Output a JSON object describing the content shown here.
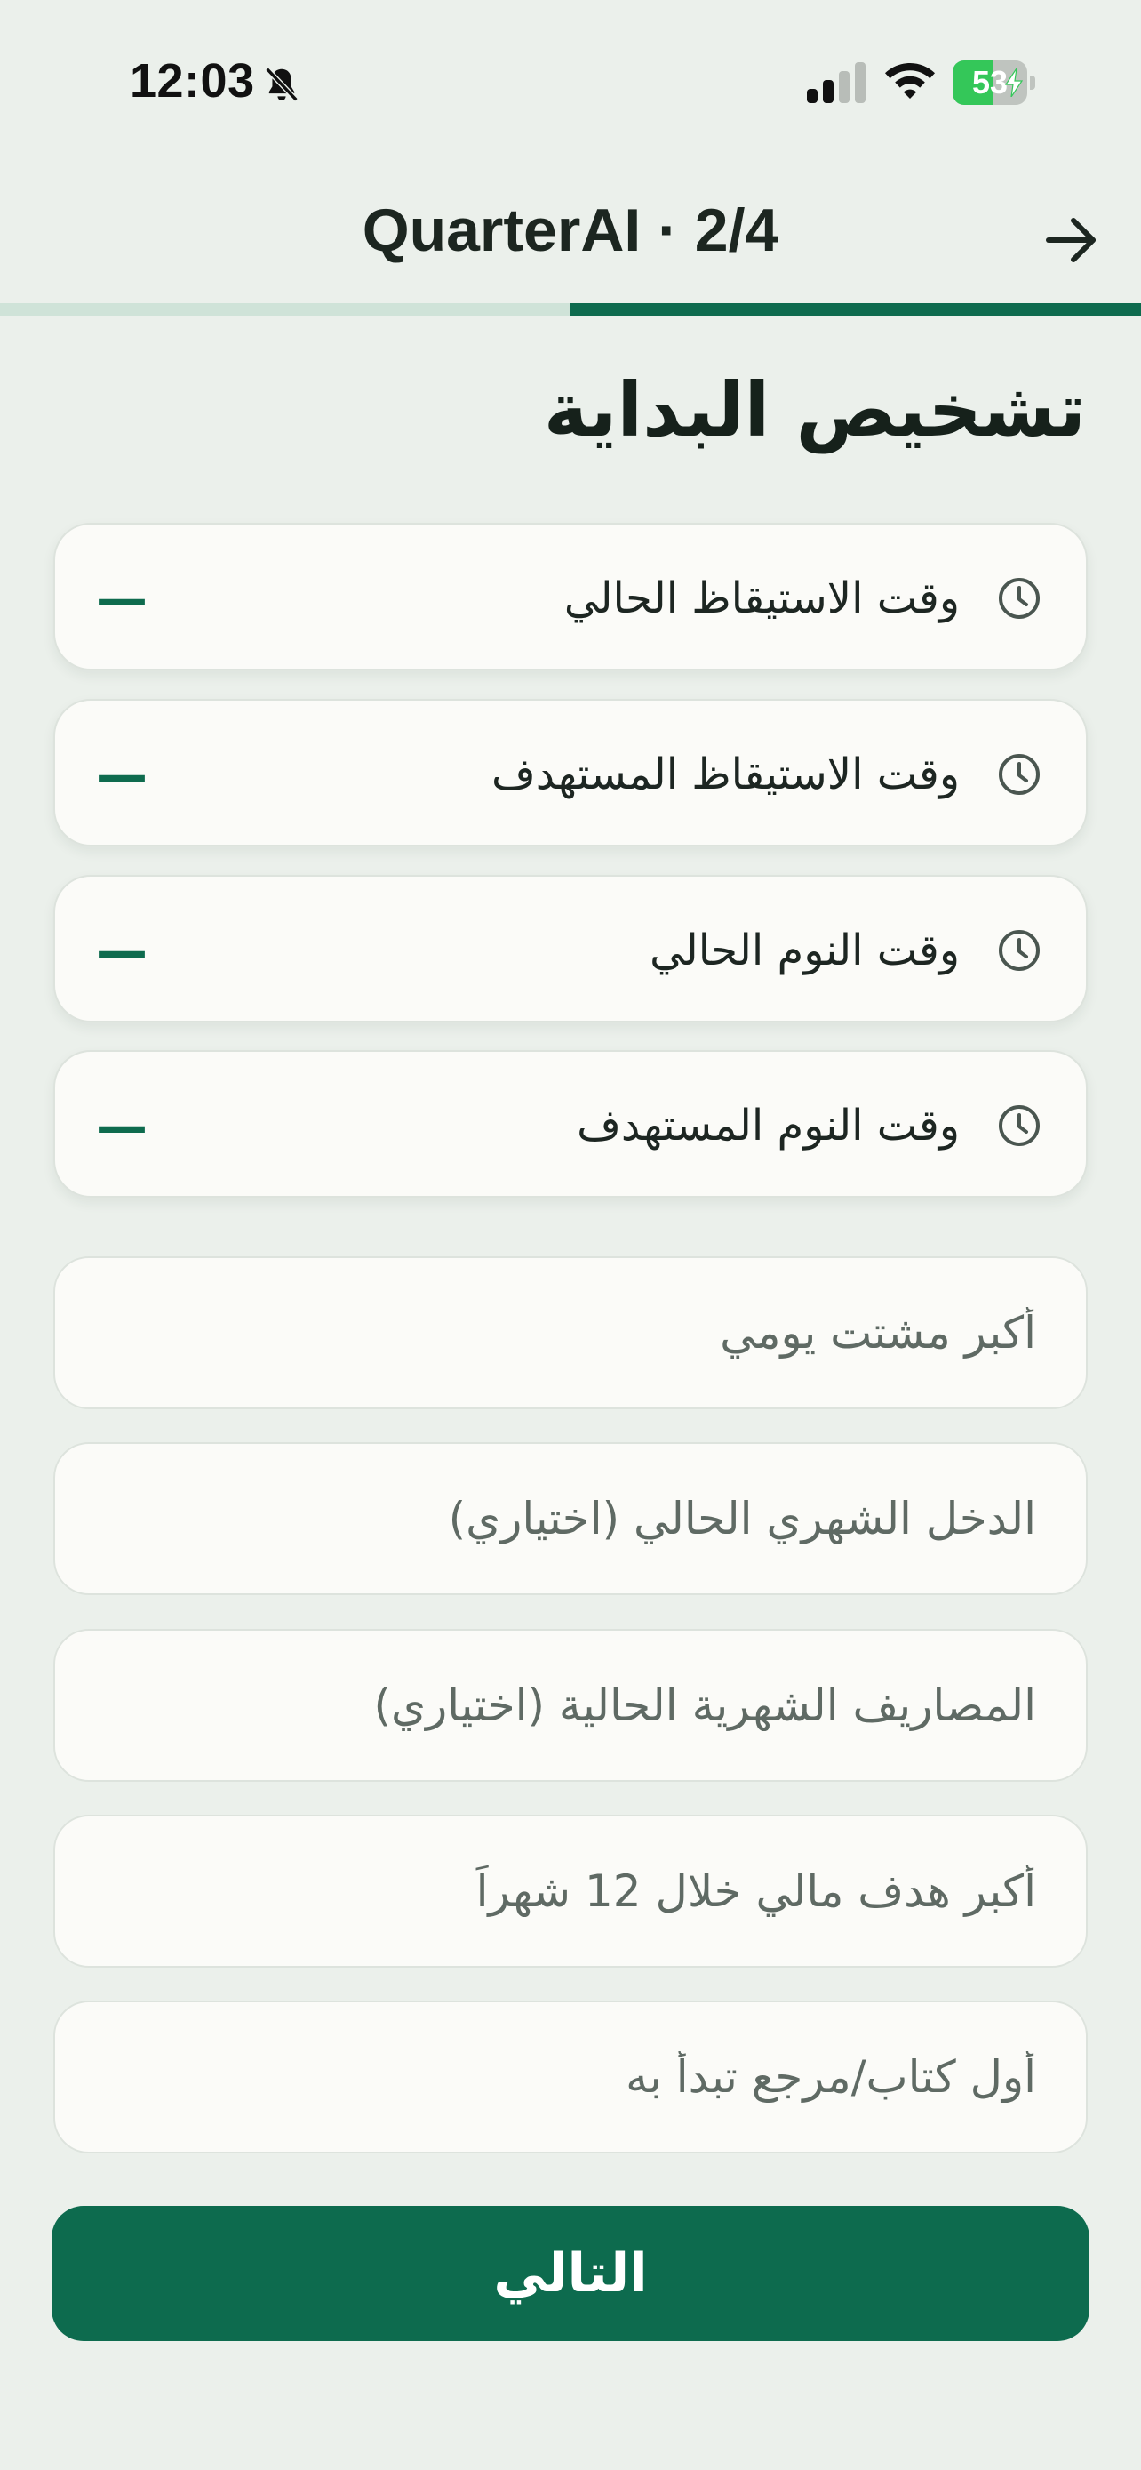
{
  "status_bar": {
    "time": "12:03",
    "battery_level": "53",
    "battery_fraction": 0.53,
    "silent_mode": true,
    "signal_bars_active": 2,
    "signal_bars_total": 4
  },
  "header": {
    "title": "QuarterAI · 2/4",
    "back_icon": "arrow-right-icon"
  },
  "progress": {
    "step": 2,
    "total": 4,
    "fraction": 0.5,
    "fill_color": "#0e6b4e",
    "track_color": "#cfe3d8"
  },
  "page": {
    "title": "تشخيص البداية"
  },
  "time_rows": [
    {
      "label": "وقت الاستيقاظ الحالي",
      "value": "—",
      "icon": "clock-icon"
    },
    {
      "label": "وقت الاستيقاظ المستهدف",
      "value": "—",
      "icon": "clock-icon"
    },
    {
      "label": "وقت النوم الحالي",
      "value": "—",
      "icon": "clock-icon"
    },
    {
      "label": "وقت النوم المستهدف",
      "value": "—",
      "icon": "clock-icon"
    }
  ],
  "fields": [
    {
      "placeholder": "أكبر مشتت يومي",
      "value": ""
    },
    {
      "placeholder": "الدخل الشهري الحالي (اختياري)",
      "value": ""
    },
    {
      "placeholder": "المصاريف الشهرية الحالية (اختياري)",
      "value": ""
    },
    {
      "placeholder": "أكبر هدف مالي خلال 12 شهراً",
      "value": ""
    },
    {
      "placeholder": "أول كتاب/مرجع تبدأ به",
      "value": ""
    }
  ],
  "next_button": {
    "label": "التالي",
    "color": "#0d6b4e"
  },
  "colors": {
    "background": "#ebf0eb",
    "card": "#fbfbf8",
    "accent": "#0e6b4e"
  }
}
